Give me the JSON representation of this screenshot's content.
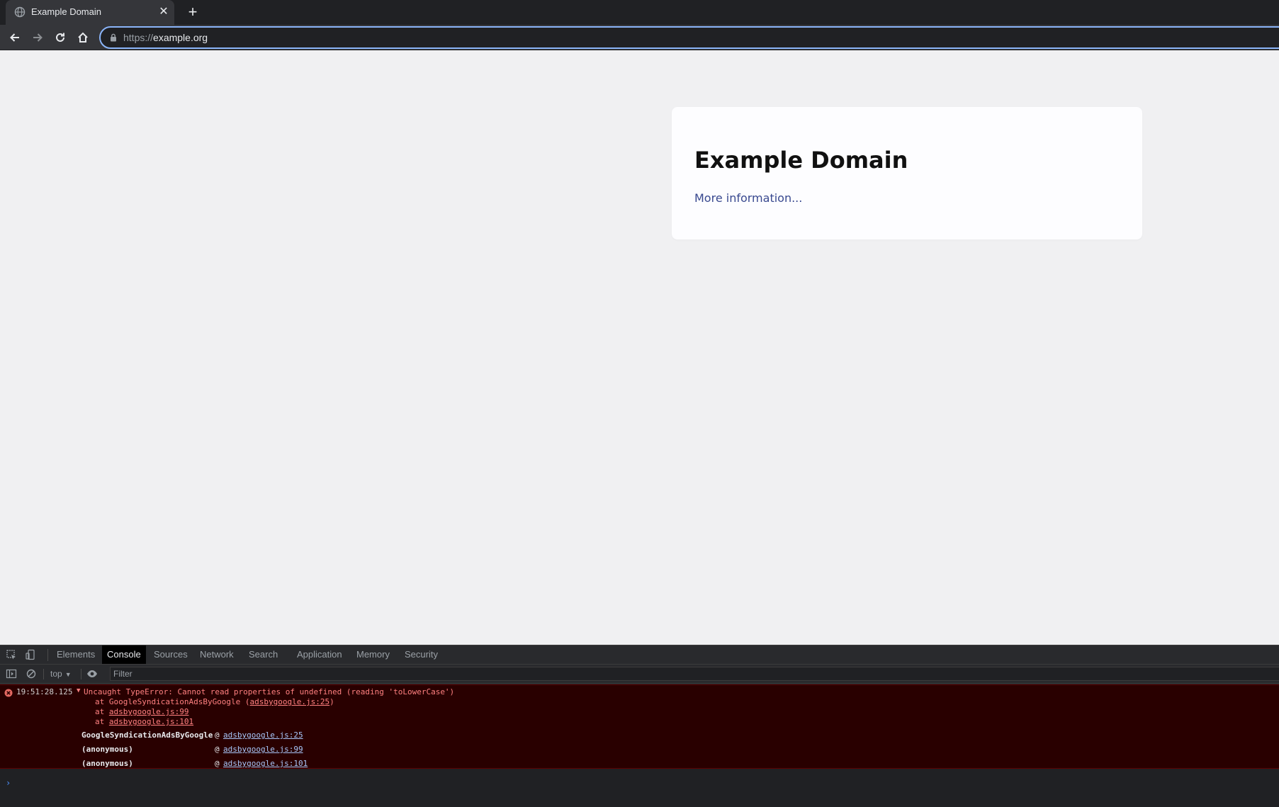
{
  "browser": {
    "tab_title": "Example Domain",
    "tab_close_glyph": "✕",
    "new_tab_glyph": "+",
    "url_scheme": "https://",
    "url_host": "example.org",
    "icons": [
      "globe-icon",
      "back-icon",
      "forward-icon",
      "reload-icon",
      "home-icon",
      "lock-icon"
    ]
  },
  "page": {
    "heading": "Example Domain",
    "link_text": "More information..."
  },
  "devtools": {
    "tabs": [
      {
        "label": "Elements"
      },
      {
        "label": "Console"
      },
      {
        "label": "Sources"
      },
      {
        "label": "Network"
      },
      {
        "label": "Search"
      },
      {
        "label": "Application"
      },
      {
        "label": "Memory"
      },
      {
        "label": "Security"
      }
    ],
    "active_tab": "Console",
    "context": "top",
    "context_caret": "▼",
    "filter_placeholder": "Filter",
    "prompt_glyph": "›",
    "error": {
      "time": "19:51:28.125",
      "toggle": "▼",
      "message": "Uncaught TypeError: Cannot read properties of undefined (reading 'toLowerCase')",
      "stack": [
        {
          "prefix": "at GoogleSyndicationAdsByGoogle (",
          "link": "adsbygoogle.js:25",
          "suffix": ")"
        },
        {
          "prefix": "at ",
          "link": "adsbygoogle.js:99",
          "suffix": ""
        },
        {
          "prefix": "at ",
          "link": "adsbygoogle.js:101",
          "suffix": ""
        }
      ],
      "trace": [
        {
          "fn": "GoogleSyndicationAdsByGoogle",
          "at": "@",
          "link": "adsbygoogle.js:25"
        },
        {
          "fn": "(anonymous)",
          "at": "@",
          "link": "adsbygoogle.js:99"
        },
        {
          "fn": "(anonymous)",
          "at": "@",
          "link": "adsbygoogle.js:101"
        }
      ]
    },
    "colors": {
      "error_bg": "#290000",
      "error_text": "#ff8080",
      "link": "#a8c7fa",
      "active_tab_bg": "#000000"
    }
  }
}
